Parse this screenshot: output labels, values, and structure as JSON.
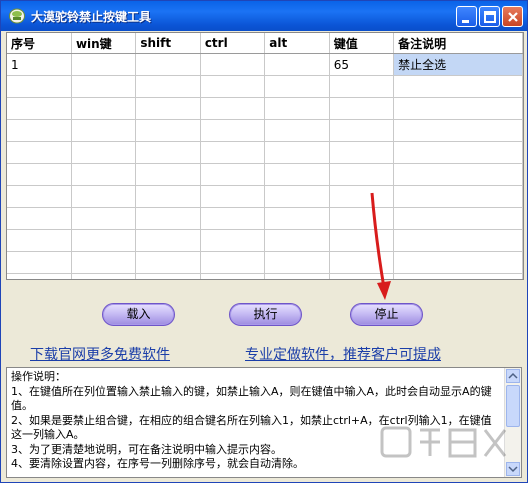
{
  "window": {
    "title": "大漠驼铃禁止按键工具",
    "accent_color": "#0a5ee0"
  },
  "grid": {
    "columns": [
      "序号",
      "win键",
      "shift",
      "ctrl",
      "alt",
      "键值",
      "备注说明"
    ],
    "rows": [
      [
        "1",
        "",
        "",
        "",
        "",
        "65",
        "禁止全选"
      ]
    ],
    "selected_cell_color": "#c3d7f5"
  },
  "buttons": {
    "load_label": "载入",
    "exec_label": "执行",
    "stop_label": "停止"
  },
  "links": {
    "download": "下载官网更多免费软件",
    "custom": "专业定做软件，推荐客户可提成"
  },
  "notes": {
    "text": "操作说明：\n1、在键值所在列位置输入禁止输入的键，如禁止输入A，则在键值中输入A，此时会自动显示A的键值。\n2、如果是要禁止组合键，在相应的组合键名所在列输入1，如禁止ctrl+A，在ctrl列输入1，在键值这一列输入A。\n3、为了更清楚地说明，可在备注说明中输入提示内容。\n4、要清除设置内容，在序号一列删除序号，就会自动清除。"
  },
  "icons": {
    "app": "app-icon",
    "minimize": "minimize-icon",
    "maximize": "maximize-icon",
    "close": "close-icon",
    "annotation": "red-arrow-icon"
  }
}
